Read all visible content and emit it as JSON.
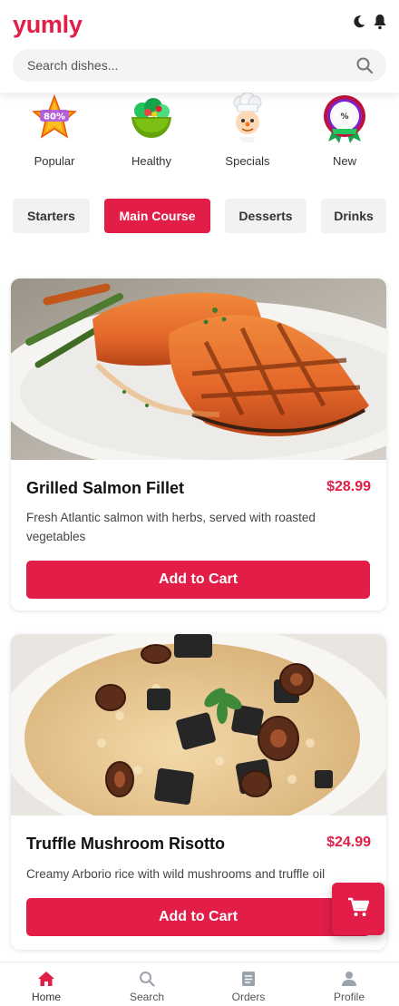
{
  "app": {
    "logo": "yumly"
  },
  "header": {
    "theme_icon": "moon-icon",
    "notif_icon": "bell-icon"
  },
  "search": {
    "placeholder": "Search dishes..."
  },
  "categories": [
    {
      "label": "Popular",
      "icon": "star-badge-icon",
      "badge_text": "80%"
    },
    {
      "label": "Healthy",
      "icon": "salad-bowl-icon"
    },
    {
      "label": "Specials",
      "icon": "chef-icon"
    },
    {
      "label": "New",
      "icon": "new-ribbon-icon",
      "badge_text": "%"
    }
  ],
  "tabs": [
    {
      "label": "Starters",
      "active": false
    },
    {
      "label": "Main Course",
      "active": true
    },
    {
      "label": "Desserts",
      "active": false
    },
    {
      "label": "Drinks",
      "active": false
    }
  ],
  "dishes": [
    {
      "name": "Grilled Salmon Fillet",
      "price": "$28.99",
      "description": "Fresh Atlantic salmon with herbs, served with roasted vegetables",
      "button": "Add to Cart"
    },
    {
      "name": "Truffle Mushroom Risotto",
      "price": "$24.99",
      "description": "Creamy Arborio rice with wild mushrooms and truffle oil",
      "button": "Add to Cart"
    }
  ],
  "cart_fab": {
    "icon": "cart-icon"
  },
  "nav": [
    {
      "label": "Home",
      "icon": "home-icon",
      "active": true
    },
    {
      "label": "Search",
      "icon": "search-icon"
    },
    {
      "label": "Orders",
      "icon": "orders-icon"
    },
    {
      "label": "Profile",
      "icon": "user-icon"
    }
  ],
  "colors": {
    "accent": "#e11d48",
    "tab_bg": "#f1f2f4",
    "search_bg": "#f3f4f6"
  }
}
